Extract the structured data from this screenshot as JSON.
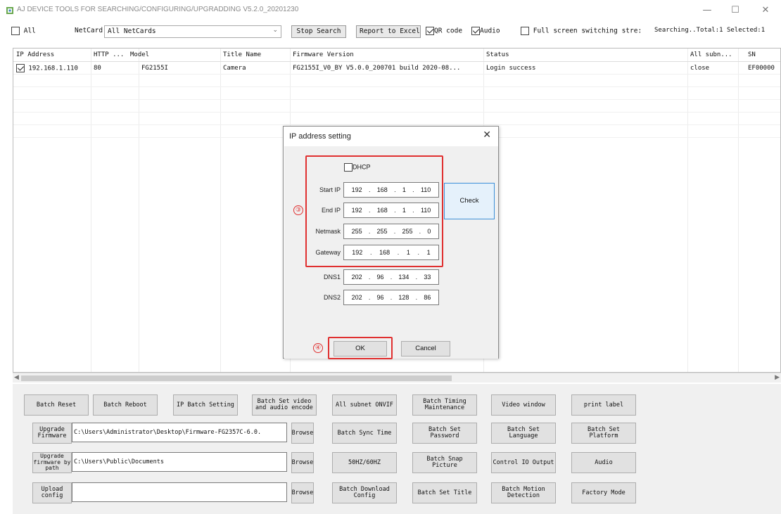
{
  "window": {
    "title": "AJ DEVICE TOOLS FOR SEARCHING/CONFIGURING/UPGRADDING V5.2.0_20201230",
    "minimize": "—",
    "maximize": "☐",
    "close": "✕"
  },
  "toolbar": {
    "all_label": "All",
    "netcard_label": "NetCard",
    "netcard_value": "All NetCards",
    "stop_search": "Stop Search",
    "report_excel": "Report to Excel",
    "qr_code": "QR code",
    "audio": "Audio",
    "fullscreen": "Full screen switching stre:",
    "status": "Searching..Total:1 Selected:1"
  },
  "table": {
    "headers": [
      "IP Address",
      "HTTP ...",
      "Model",
      "Title Name",
      "Firmware Version",
      "Status",
      "All subn...",
      "SN"
    ],
    "rows": [
      [
        "192.168.1.110",
        "80",
        "FG2155I",
        "Camera",
        "FG2155I_V0_BY V5.0.0_200701 build 2020-08...",
        "Login success",
        "close",
        "EF00000"
      ]
    ]
  },
  "bottom": {
    "row1": [
      "Batch Reset",
      "Batch Reboot",
      "IP Batch Setting",
      "Batch Set video\nand audio encode",
      "All subnet ONVIF",
      "Batch Timing\nMaintenance",
      "Video window",
      "print label"
    ],
    "upgrade_firmware": "Upgrade\nFirmware",
    "firmware_path": "C:\\Users\\Administrator\\Desktop\\Firmware-FG2357C-6.0.",
    "browse": "Browse",
    "row2": [
      "Batch Sync Time",
      "Batch Set\nPassword",
      "Batch Set\nLanguage",
      "Batch Set\nPlatform"
    ],
    "upgrade_by_path": "Upgrade\nfirmware by\npath",
    "path_value": "C:\\Users\\Public\\Documents",
    "row3": [
      "50HZ/60HZ",
      "Batch Snap\nPicture",
      "Control IO Output",
      "Audio"
    ],
    "upload_config": "Upload\nconfig",
    "config_value": "",
    "row4": [
      "Batch Download\nConfig",
      "Batch Set Title",
      "Batch Motion\nDetection",
      "Factory Mode"
    ]
  },
  "dialog": {
    "title": "IP address setting",
    "close": "✕",
    "dhcp": "DHCP",
    "start_ip_label": "Start IP",
    "start_ip": [
      "192",
      "168",
      "1",
      "110"
    ],
    "end_ip_label": "End IP",
    "end_ip": [
      "192",
      "168",
      "1",
      "110"
    ],
    "netmask_label": "Netmask",
    "netmask": [
      "255",
      "255",
      "255",
      "0"
    ],
    "gateway_label": "Gateway",
    "gateway": [
      "192",
      "168",
      "1",
      "1"
    ],
    "dns1_label": "DNS1",
    "dns1": [
      "202",
      "96",
      "134",
      "33"
    ],
    "dns2_label": "DNS2",
    "dns2": [
      "202",
      "96",
      "128",
      "86"
    ],
    "check": "Check",
    "ok": "OK",
    "cancel": "Cancel",
    "marker_3": "③",
    "marker_4": "④"
  },
  "colors": {
    "highlight_red": "#e03030",
    "check_blue": "#3b8fd8"
  }
}
